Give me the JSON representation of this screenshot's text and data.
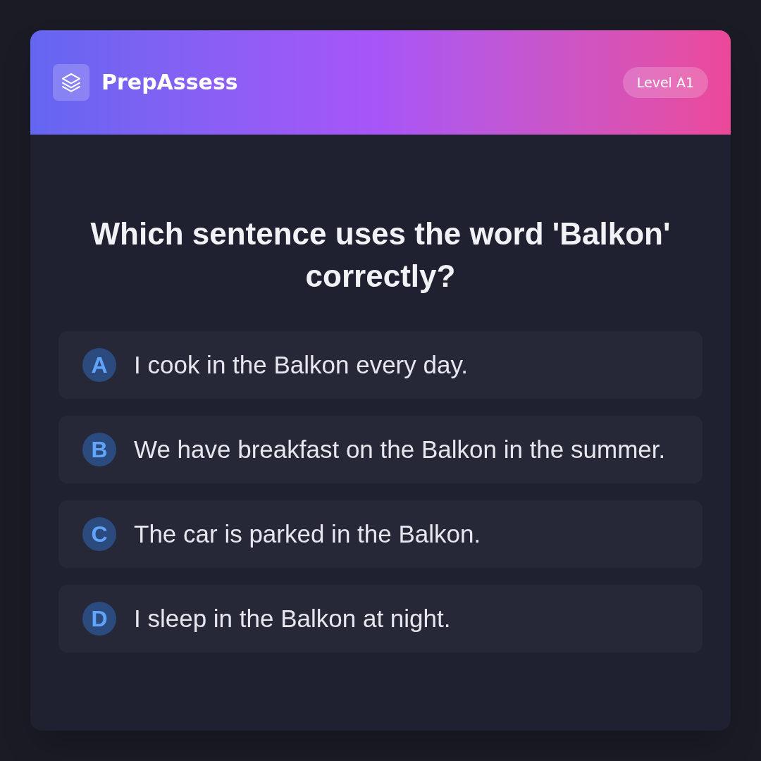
{
  "header": {
    "brand": "PrepAssess",
    "badge": "Level A1"
  },
  "question": "Which sentence uses the word 'Balkon' correctly?",
  "options": [
    {
      "letter": "A",
      "text": "I cook in the Balkon every day.",
      "selected": false
    },
    {
      "letter": "B",
      "text": "We have breakfast on the Balkon in the summer.",
      "selected": false
    },
    {
      "letter": "C",
      "text": "The car is parked in the Balkon.",
      "selected": false
    },
    {
      "letter": "D",
      "text": "I sleep in the Balkon at night.",
      "selected": false
    }
  ]
}
